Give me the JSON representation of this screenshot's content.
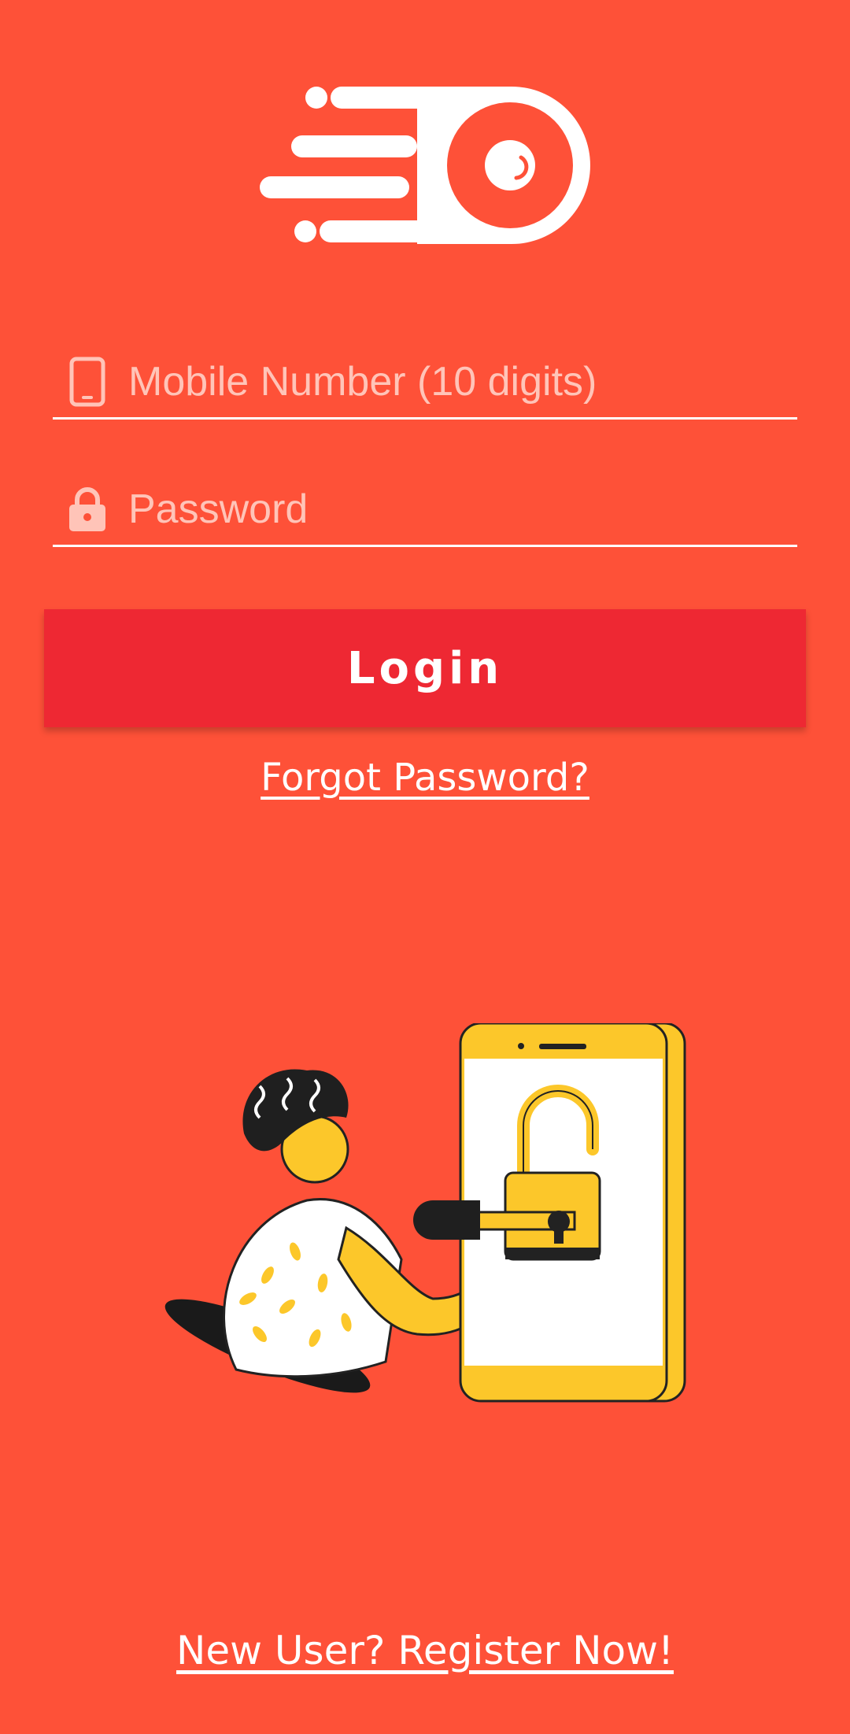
{
  "logo": {
    "icon": "speed-eye-logo-icon",
    "color": "#FFFFFF"
  },
  "form": {
    "mobile_placeholder": "Mobile Number (10 digits)",
    "mobile_value": "",
    "mobile_icon": "mobile-phone-icon",
    "password_placeholder": "Password",
    "password_value": "",
    "password_icon": "lock-icon",
    "login_label": "Login",
    "forgot_label": "Forgot Password?"
  },
  "illustration": {
    "name": "person-unlocking-phone-illustration",
    "accent": "#FCC72A"
  },
  "footer": {
    "register_label": "New User? Register Now!"
  },
  "colors": {
    "background": "#FE5138",
    "button": "#EE2833",
    "text": "#FFFFFF"
  }
}
